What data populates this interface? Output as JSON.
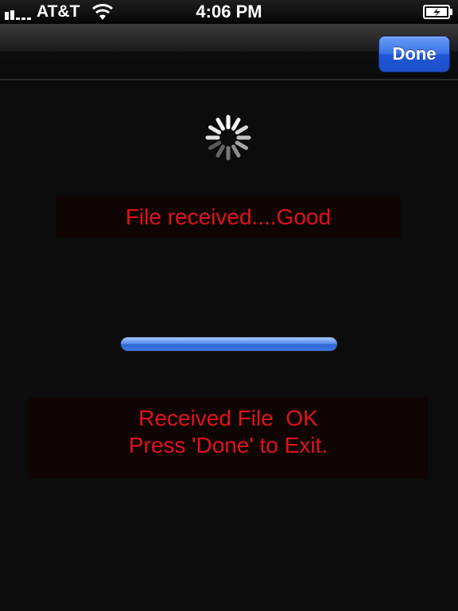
{
  "status_bar": {
    "carrier": "AT&T",
    "time": "4:06 PM",
    "icons": [
      "signal-bars-icon",
      "wifi-icon",
      "battery-charging-icon"
    ]
  },
  "nav_bar": {
    "done_label": "Done"
  },
  "spinner": {
    "icon": "activity-spinner-icon"
  },
  "messages": {
    "status": "File received....Good",
    "result_line1": "Received File  OK",
    "result_line2": "Press 'Done' to Exit."
  },
  "progress": {
    "value": 1.0
  },
  "colors": {
    "message_text": "#e3111a",
    "button_blue": "#2f62dc",
    "progress_blue": "#3f78e3",
    "background": "#0c0c0c"
  }
}
